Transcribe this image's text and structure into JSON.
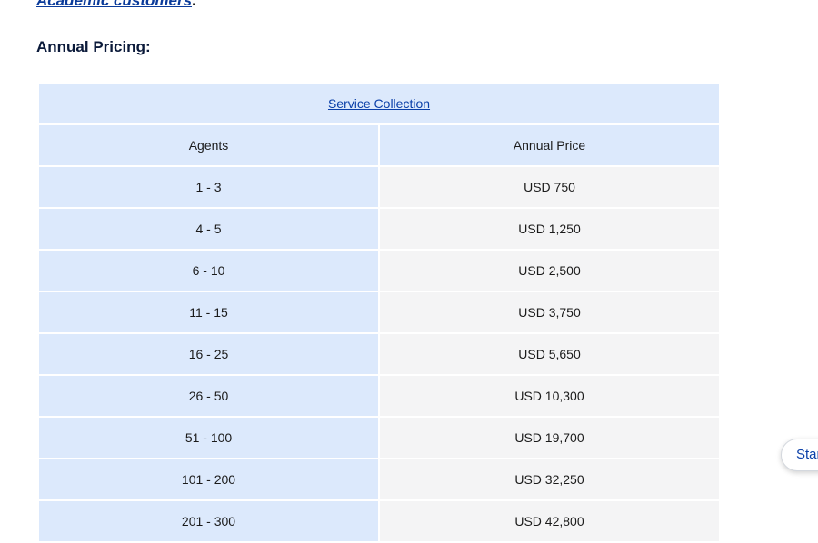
{
  "intro": {
    "link_text": "Academic customers",
    "trailing": "."
  },
  "heading": "Annual Pricing:",
  "table": {
    "caption_link": "Service Collection",
    "headers": [
      "Agents",
      "Annual Price"
    ],
    "rows": [
      [
        "1 - 3",
        "USD 750"
      ],
      [
        "4 - 5",
        "USD 1,250"
      ],
      [
        "6 - 10",
        "USD 2,500"
      ],
      [
        "11 - 15",
        "USD 3,750"
      ],
      [
        "16 - 25",
        "USD 5,650"
      ],
      [
        "26 - 50",
        "USD 10,300"
      ],
      [
        "51 - 100",
        "USD 19,700"
      ],
      [
        "101 - 200",
        "USD 32,250"
      ],
      [
        "201 - 300",
        "USD 42,800"
      ]
    ]
  },
  "floating_button": {
    "label": "Start"
  },
  "colors": {
    "link": "#0a3fa8",
    "header_cell": "#dce9fc",
    "value_cell": "#f4f4f5"
  }
}
